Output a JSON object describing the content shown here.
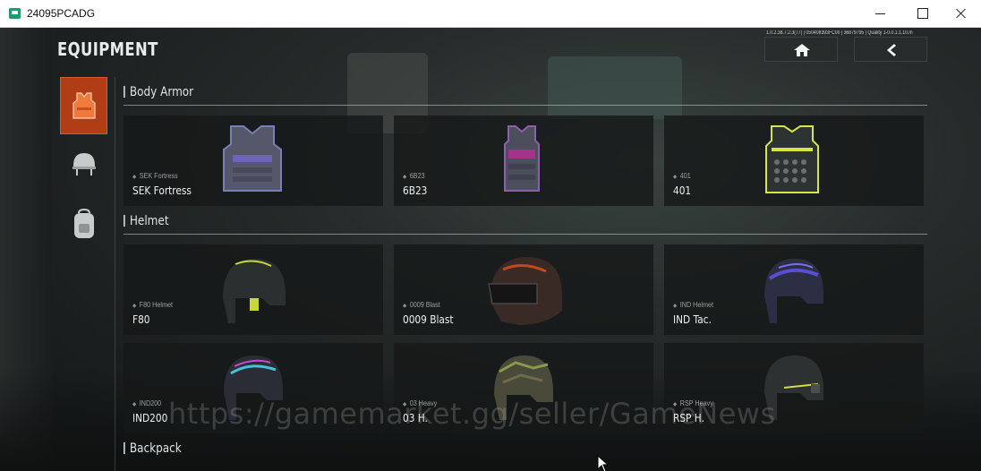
{
  "window": {
    "title": "24095PCADG"
  },
  "header": {
    "title": "EQUIPMENT",
    "build_info": "1.0.2.38.7.2.3(77) | 050408393FC00 | 36879795 | Quality 1-0.0.1.1.10.m"
  },
  "nav": {
    "home_icon": "home-icon",
    "back_icon": "back-chevron-icon"
  },
  "categories": [
    {
      "name": "body-armor",
      "icon": "vest-icon",
      "active": true
    },
    {
      "name": "helmet",
      "icon": "helmet-icon",
      "active": false
    },
    {
      "name": "backpack",
      "icon": "backpack-icon",
      "active": false
    }
  ],
  "sections": {
    "body_armor": {
      "title": "Body Armor",
      "items": [
        {
          "sub": "SEK Fortress",
          "name": "SEK Fortress",
          "accent": "#6d63b8"
        },
        {
          "sub": "6B23",
          "name": "6B23",
          "accent": "#a3348a"
        },
        {
          "sub": "401",
          "name": "401",
          "accent": "#d6e34a"
        }
      ]
    },
    "helmet": {
      "title": "Helmet",
      "items": [
        {
          "sub": "F80 Helmet",
          "name": "F80",
          "accent": "#c8d63a"
        },
        {
          "sub": "0009 Blast",
          "name": "0009 Blast",
          "accent": "#c04a1c"
        },
        {
          "sub": "IND Helmet",
          "name": "IND Tac.",
          "accent": "#5a4fd0"
        },
        {
          "sub": "IND200",
          "name": "IND200",
          "accent": "#47c3d8"
        },
        {
          "sub": "03 Heavy",
          "name": "03 H.",
          "accent": "#8a9a4a"
        },
        {
          "sub": "RSP Heavy",
          "name": "RSP H.",
          "accent": "#d4d94a"
        }
      ]
    },
    "backpack": {
      "title": "Backpack"
    }
  },
  "watermark": "https://gamemarket.gg/seller/GameNews",
  "colors": {
    "active_tab": "#b13d17",
    "text": "#eef1f1"
  }
}
